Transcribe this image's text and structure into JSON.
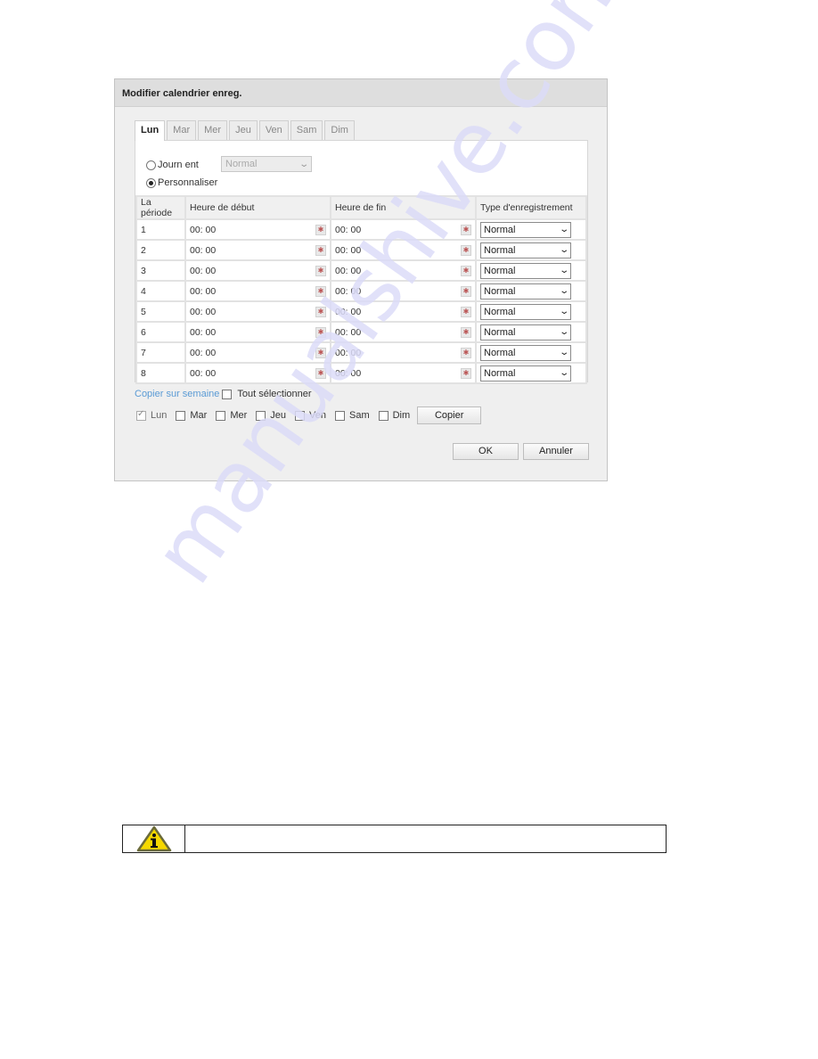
{
  "dialog": {
    "title": "Modifier calendrier enreg.",
    "tabs": [
      {
        "label": "Lun",
        "active": true
      },
      {
        "label": "Mar",
        "active": false
      },
      {
        "label": "Mer",
        "active": false
      },
      {
        "label": "Jeu",
        "active": false
      },
      {
        "label": "Ven",
        "active": false
      },
      {
        "label": "Sam",
        "active": false
      },
      {
        "label": "Dim",
        "active": false
      }
    ],
    "mode": {
      "all_day_label": "Journ ent",
      "all_day_selected": false,
      "all_day_type": "Normal",
      "custom_label": "Personnaliser",
      "custom_selected": true
    },
    "table": {
      "headers": [
        "La période",
        "Heure de début",
        "Heure de fin",
        "Type d'enregistrement"
      ],
      "rows": [
        {
          "period": "1",
          "start": "00: 00",
          "end": "00: 00",
          "type": "Normal"
        },
        {
          "period": "2",
          "start": "00: 00",
          "end": "00: 00",
          "type": "Normal"
        },
        {
          "period": "3",
          "start": "00: 00",
          "end": "00: 00",
          "type": "Normal"
        },
        {
          "period": "4",
          "start": "00: 00",
          "end": "00: 00",
          "type": "Normal"
        },
        {
          "period": "5",
          "start": "00: 00",
          "end": "00: 00",
          "type": "Normal"
        },
        {
          "period": "6",
          "start": "00: 00",
          "end": "00: 00",
          "type": "Normal"
        },
        {
          "period": "7",
          "start": "00: 00",
          "end": "00: 00",
          "type": "Normal"
        },
        {
          "period": "8",
          "start": "00: 00",
          "end": "00: 00",
          "type": "Normal"
        }
      ],
      "clock_icon": "clock-icon"
    },
    "copy": {
      "link_label": "Copier sur semaine",
      "select_all_label": "Tout sélectionner",
      "select_all_checked": false,
      "days": [
        {
          "label": "Lun",
          "checked": true
        },
        {
          "label": "Mar",
          "checked": false
        },
        {
          "label": "Mer",
          "checked": false
        },
        {
          "label": "Jeu",
          "checked": false
        },
        {
          "label": "Ven",
          "checked": false
        },
        {
          "label": "Sam",
          "checked": false
        },
        {
          "label": "Dim",
          "checked": false
        }
      ],
      "copy_button": "Copier"
    },
    "ok_button": "OK",
    "cancel_button": "Annuler"
  },
  "info_box": {
    "icon": "info-warning-icon",
    "text": ""
  },
  "watermark": "manualshive.com",
  "colors": {
    "link": "#5b9bd5",
    "info_icon_fill": "#f5d800"
  }
}
